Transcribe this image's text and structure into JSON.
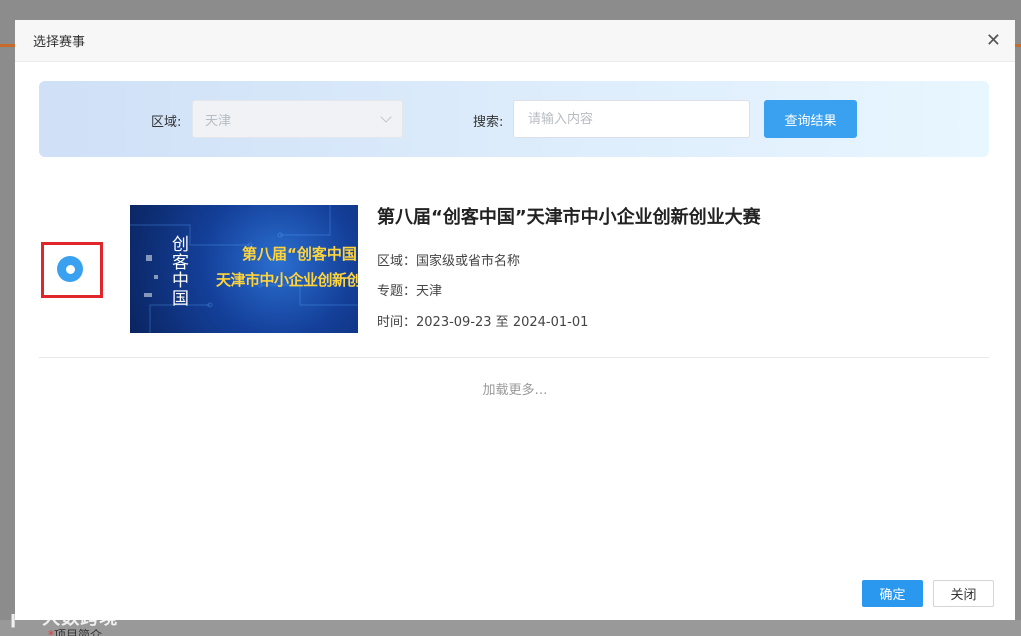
{
  "dialog": {
    "title": "选择赛事",
    "close_icon": "close-icon ×"
  },
  "filter": {
    "region_label": "区域:",
    "region_value": "天津",
    "search_label": "搜索:",
    "search_placeholder": "请输入内容",
    "query_button": "查询结果"
  },
  "events": [
    {
      "selected": true,
      "thumb_logo": "创客中国",
      "thumb_line1": "第八届“创客中国”",
      "thumb_line2": "天津市中小企业创新创业大赛",
      "title": "第八届“创客中国”天津市中小企业创新创业大赛",
      "region": "区域：国家级或省市名称",
      "topic": "专题：天津",
      "time": "时间：2023-09-23 至 2024-01-01"
    }
  ],
  "load_more": "加载更多…",
  "footer": {
    "confirm_button": "确定",
    "close_button": "关闭"
  },
  "backdrop": {
    "watermark": "大数跨境",
    "bottom_label": "项目简介"
  },
  "colors": {
    "accent": "#3aa0f0",
    "highlight_box": "#e0262a",
    "thumb_text": "#ffd43b"
  }
}
